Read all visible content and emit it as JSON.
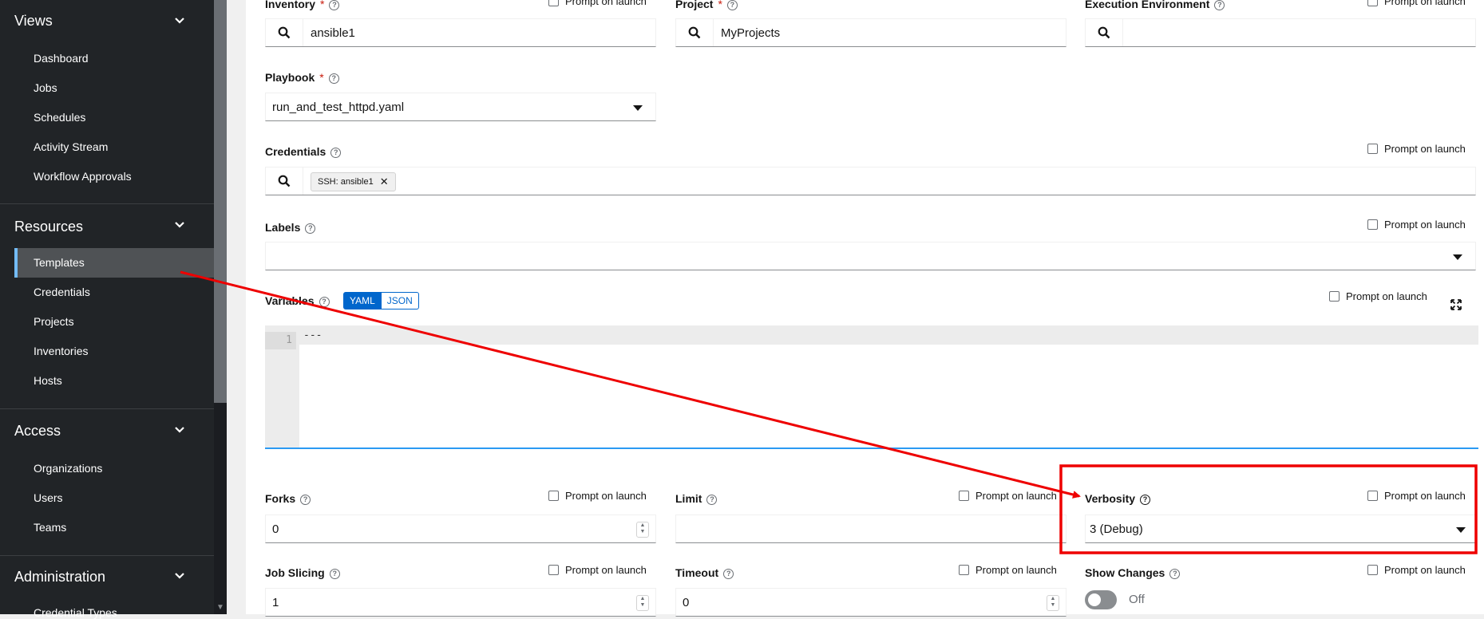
{
  "sidebar": {
    "groups": [
      {
        "label": "Views",
        "items": [
          "Dashboard",
          "Jobs",
          "Schedules",
          "Activity Stream",
          "Workflow Approvals"
        ]
      },
      {
        "label": "Resources",
        "items": [
          "Templates",
          "Credentials",
          "Projects",
          "Inventories",
          "Hosts"
        ]
      },
      {
        "label": "Access",
        "items": [
          "Organizations",
          "Users",
          "Teams"
        ]
      },
      {
        "label": "Administration",
        "items": [
          "Credential Types"
        ]
      }
    ],
    "active_item": "Templates"
  },
  "form": {
    "prompt_label": "Prompt on launch",
    "inventory": {
      "label": "Inventory",
      "required": "*",
      "value": "ansible1"
    },
    "project": {
      "label": "Project",
      "required": "*",
      "value": "MyProjects"
    },
    "execution_environment": {
      "label": "Execution Environment",
      "value": ""
    },
    "playbook": {
      "label": "Playbook",
      "required": "*",
      "value": "run_and_test_httpd.yaml"
    },
    "credentials": {
      "label": "Credentials",
      "chip": "SSH: ansible1"
    },
    "labels": {
      "label": "Labels",
      "value": ""
    },
    "variables": {
      "label": "Variables",
      "yaml": "YAML",
      "json": "JSON",
      "line_number": "1",
      "code": "---"
    },
    "forks": {
      "label": "Forks",
      "value": "0"
    },
    "limit": {
      "label": "Limit",
      "value": ""
    },
    "verbosity": {
      "label": "Verbosity",
      "value": "3 (Debug)"
    },
    "job_slicing": {
      "label": "Job Slicing",
      "value": "1"
    },
    "timeout": {
      "label": "Timeout",
      "value": "0"
    },
    "show_changes": {
      "label": "Show Changes",
      "state": "Off"
    }
  },
  "annotation": {
    "color": "#ee0000"
  }
}
